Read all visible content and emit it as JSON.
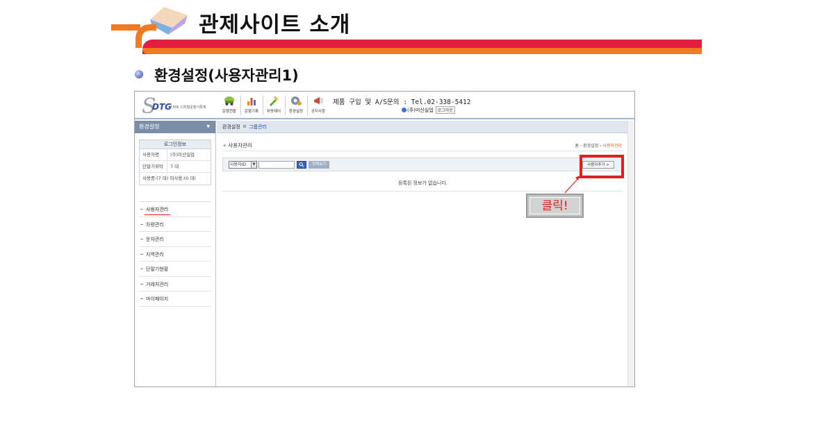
{
  "slide": {
    "title": "관제사이트 소개",
    "section_title": "환경설정(사용자관리1)"
  },
  "app": {
    "logo": {
      "mark": "S",
      "brand": "DTG",
      "subtitle": "스마트 디지털운행기록계"
    },
    "top_nav": [
      {
        "label": "운행현황",
        "icon": "car-icon"
      },
      {
        "label": "운행기록",
        "icon": "chart-icon"
      },
      {
        "label": "차량제어",
        "icon": "wrench-icon"
      },
      {
        "label": "환경설정",
        "icon": "gear-icon"
      },
      {
        "label": "공지사항",
        "icon": "megaphone-icon"
      }
    ],
    "contact": "제품 구입 및 A/S문의 : Tel.02-338-5412",
    "user": {
      "company": "(주)미산실업",
      "logout_label": "로그아웃"
    },
    "sidebar": {
      "header": "환경설정",
      "header_arrow": "▼",
      "login_info": {
        "title": "로그인정보",
        "rows": [
          {
            "key": "사용자명",
            "value": "(주)미산실업"
          },
          {
            "key": "단말기위탁",
            "value": "7 대"
          }
        ],
        "usage": "사용중:(7 대)  미사용:(0 대)"
      },
      "menu": [
        {
          "label": "사용자관리"
        },
        {
          "label": "차량관리"
        },
        {
          "label": "운자관리"
        },
        {
          "label": "지역관리"
        },
        {
          "label": "단말기현황"
        },
        {
          "label": "거래처관리"
        },
        {
          "label": "마이페이지"
        }
      ]
    },
    "content": {
      "tabs": {
        "primary": "환경설정",
        "secondary": "그룹관리"
      },
      "page_title": "사용자관리",
      "breadcrumb": {
        "home": "홈",
        "parent": "환경설정",
        "current": "사용자관리"
      },
      "search": {
        "select_value": "사용자ID",
        "input_value": "",
        "view_all_label": "전체보기"
      },
      "add_user_label": "사용자추가 >",
      "empty_message": "등록된 정보가 없습니다."
    }
  },
  "callout": {
    "label": "클릭!"
  },
  "colors": {
    "accent_red": "#e31e3c",
    "accent_orange": "#f47a20",
    "brand_blue": "#2a4aa8"
  }
}
